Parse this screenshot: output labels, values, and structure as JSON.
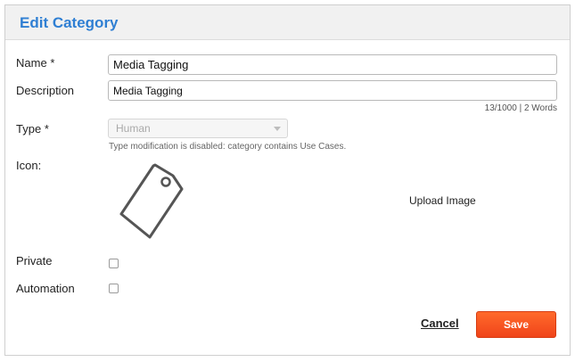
{
  "dialog": {
    "title": "Edit Category"
  },
  "form": {
    "name_label": "Name",
    "name_required": "*",
    "name_value": "Media Tagging",
    "description_label": "Description",
    "description_value": "Media Tagging",
    "description_counter": "13/1000 | 2 Words",
    "type_label": "Type",
    "type_required": "*",
    "type_value": "Human",
    "type_hint": "Type modification is disabled: category contains Use Cases.",
    "icon_label": "Icon:",
    "icon_name": "tag-icon",
    "upload_label": "Upload Image",
    "private_label": "Private",
    "private_checked": false,
    "automation_label": "Automation",
    "automation_checked": false
  },
  "actions": {
    "cancel_label": "Cancel",
    "save_label": "Save"
  },
  "colors": {
    "title": "#2f7fd3",
    "save_button": "#f0441a"
  }
}
